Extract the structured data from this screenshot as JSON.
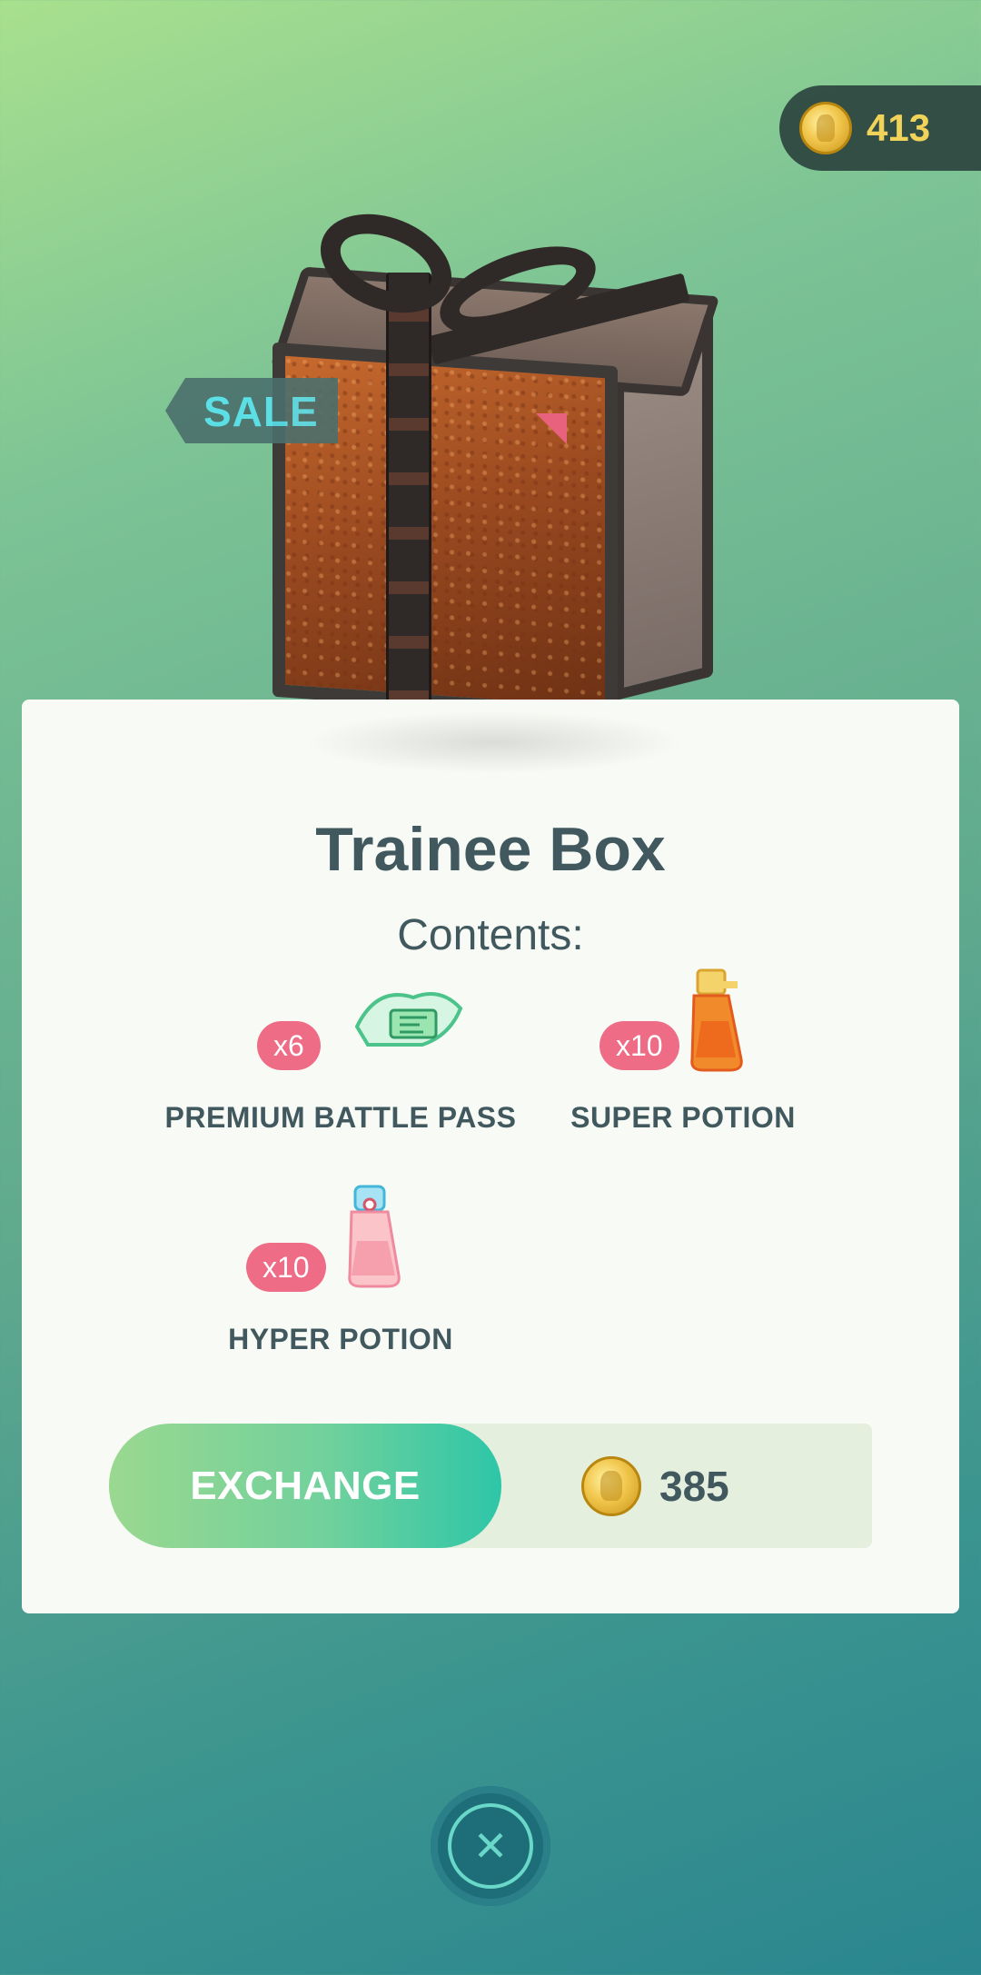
{
  "header": {
    "coin_balance": "413"
  },
  "offer": {
    "sale_badge": "SALE",
    "title": "Trainee Box",
    "contents_label": "Contents:",
    "items": [
      {
        "name": "PREMIUM BATTLE PASS",
        "quantity": "x6",
        "icon": "premium-battle-pass-icon"
      },
      {
        "name": "SUPER POTION",
        "quantity": "x10",
        "icon": "super-potion-icon"
      },
      {
        "name": "HYPER POTION",
        "quantity": "x10",
        "icon": "hyper-potion-icon"
      }
    ],
    "exchange_label": "EXCHANGE",
    "price": "385"
  },
  "footer": {
    "close_symbol": "✕"
  },
  "colors": {
    "accent_green": "#71d19c",
    "badge_pink": "#ef6c86",
    "text_slate": "#40585e",
    "coin_gold": "#f1c64c"
  }
}
